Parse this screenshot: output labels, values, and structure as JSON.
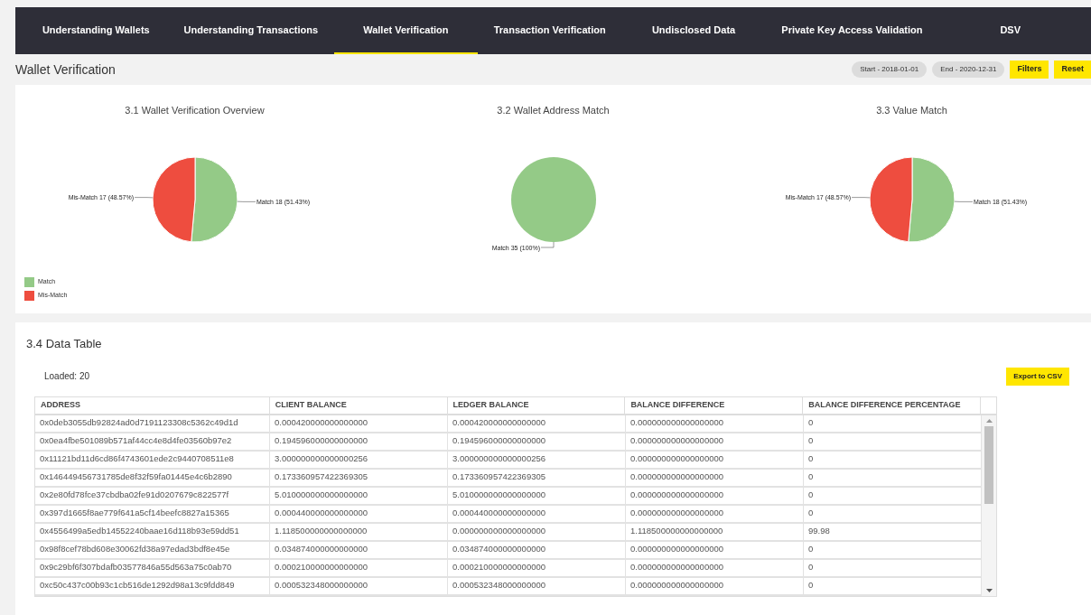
{
  "tabs": [
    {
      "label": "Understanding Wallets",
      "selected": false
    },
    {
      "label": "Understanding Transactions",
      "selected": false
    },
    {
      "label": "Wallet Verification",
      "selected": true
    },
    {
      "label": "Transaction Verification",
      "selected": false
    },
    {
      "label": "Undisclosed Data",
      "selected": false
    },
    {
      "label": "Private Key Access Validation",
      "selected": false
    },
    {
      "label": "DSV",
      "selected": false
    }
  ],
  "page_title": "Wallet Verification",
  "date_filters": [
    "Start - 2018-01-01",
    "End - 2020-12-31"
  ],
  "buttons": [
    "Filters",
    "Reset"
  ],
  "charts": [
    {
      "chart_data": {
        "type": "pie",
        "title": "3.1 Wallet Verification Overview",
        "values": [
          51.43,
          48.57
        ],
        "colors": [
          "#94ca87",
          "#ee4d3f"
        ],
        "value_labels": [
          "Match 18 (51.43%)",
          "Mis-Match 17 (48.57%)"
        ]
      }
    },
    {
      "chart_data": {
        "type": "pie",
        "title": "3.2 Wallet Address Match",
        "values": [
          100
        ],
        "colors": [
          "#94ca87"
        ],
        "value_labels": [
          "Match 35 (100%)"
        ]
      }
    },
    {
      "chart_data": {
        "type": "pie",
        "title": "3.3 Value Match",
        "values": [
          51.43,
          48.57
        ],
        "colors": [
          "#94ca87",
          "#ee4d3f"
        ],
        "value_labels": [
          "Match 18 (51.43%)",
          "Mis-Match 17 (48.57%)"
        ]
      }
    }
  ],
  "legend": [
    {
      "label": "Match",
      "color": "#94ca87"
    },
    {
      "label": "Mis-Match",
      "color": "#ee4d3f"
    }
  ],
  "table_section": {
    "title": "3.4 Data Table",
    "loaded": "Loaded: 20",
    "export_button": "Export to CSV",
    "columns": [
      "ADDRESS",
      "CLIENT BALANCE",
      "LEDGER BALANCE",
      "BALANCE DIFFERENCE",
      "BALANCE DIFFERENCE PERCENTAGE"
    ],
    "rows": [
      [
        "0x0deb3055db92824ad0d7191123308c5362c49d1d",
        "0.000420000000000000",
        "0.000420000000000000",
        "0.000000000000000000",
        "0"
      ],
      [
        "0x0ea4fbe501089b571af44cc4e8d4fe03560b97e2",
        "0.194596000000000000",
        "0.194596000000000000",
        "0.000000000000000000",
        "0"
      ],
      [
        "0x11121bd11d6cd86f4743601ede2c9440708511e8",
        "3.000000000000000256",
        "3.000000000000000256",
        "0.000000000000000000",
        "0"
      ],
      [
        "0x146449456731785de8f32f59fa01445e4c6b2890",
        "0.173360957422369305",
        "0.173360957422369305",
        "0.000000000000000000",
        "0"
      ],
      [
        "0x2e80fd78fce37cbdba02fe91d0207679c822577f",
        "5.010000000000000000",
        "5.010000000000000000",
        "0.000000000000000000",
        "0"
      ],
      [
        "0x397d1665f8ae779f641a5cf14beefc8827a15365",
        "0.000440000000000000",
        "0.000440000000000000",
        "0.000000000000000000",
        "0"
      ],
      [
        "0x4556499a5edb14552240baae16d118b93e59dd51",
        "1.118500000000000000",
        "0.000000000000000000",
        "1.118500000000000000",
        "99.98"
      ],
      [
        "0x98f8cef78bd608e30062fd38a97edad3bdf8e45e",
        "0.034874000000000000",
        "0.034874000000000000",
        "0.000000000000000000",
        "0"
      ],
      [
        "0x9c29bf6f307bdafb03577846a55d563a75c0ab70",
        "0.000210000000000000",
        "0.000210000000000000",
        "0.000000000000000000",
        "0"
      ],
      [
        "0xc50c437c00b93c1cb516de1292d98a13c9fdd849",
        "0.000532348000000000",
        "0.000532348000000000",
        "0.000000000000000000",
        "0"
      ]
    ]
  }
}
